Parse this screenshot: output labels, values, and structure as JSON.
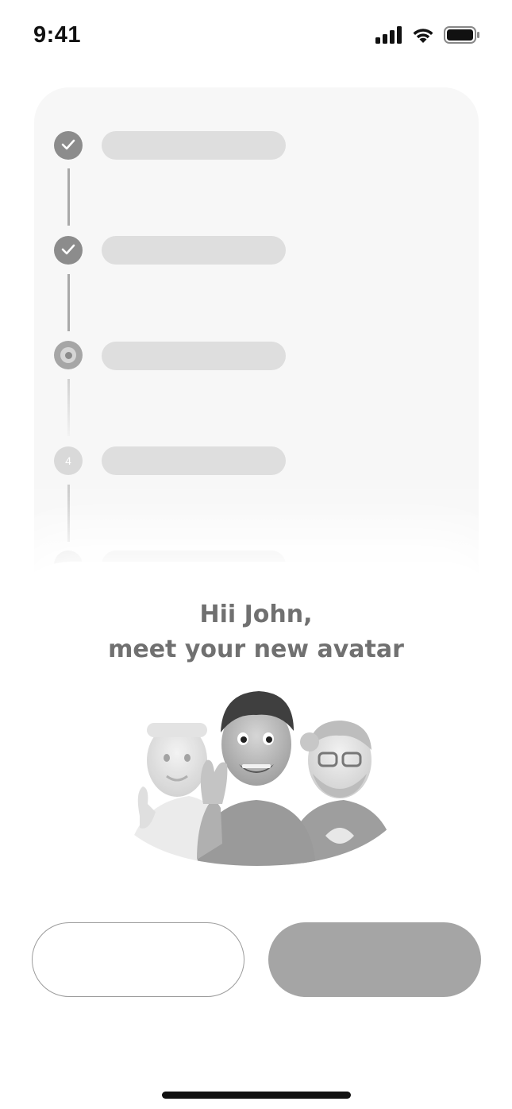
{
  "status_bar": {
    "time": "9:41",
    "icons": [
      "signal-icon",
      "wifi-icon",
      "battery-icon"
    ]
  },
  "stepper": {
    "steps": [
      {
        "state": "done",
        "icon": "check-icon"
      },
      {
        "state": "done",
        "icon": "check-icon"
      },
      {
        "state": "current",
        "icon": "current-step-icon"
      },
      {
        "state": "pending",
        "number": "4"
      },
      {
        "state": "pending"
      }
    ]
  },
  "sheet": {
    "title_line1": "Hii John,",
    "title_line2": "meet your new avatar",
    "illustration": "avatar-group-illustration"
  },
  "buttons": {
    "secondary_label": "",
    "primary_label": ""
  },
  "colors": {
    "text": "#707070",
    "primary_button": "#a5a5a5",
    "step_done": "#8c8c8c",
    "card_bg": "#f7f7f7"
  }
}
